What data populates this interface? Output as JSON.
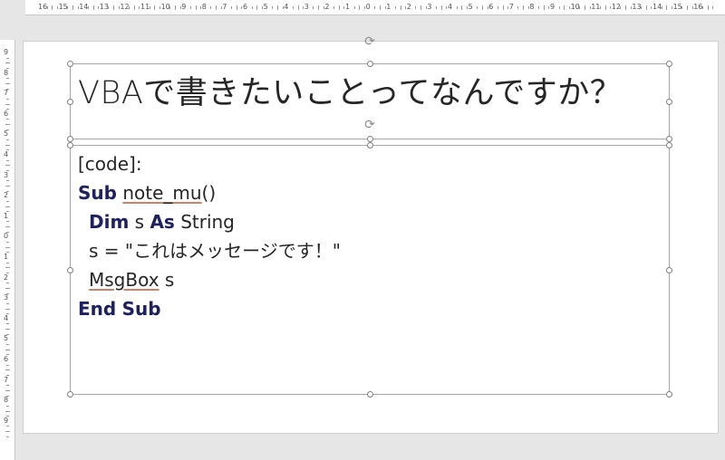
{
  "ruler": {
    "top_labels": [
      "16",
      "15",
      "14",
      "13",
      "12",
      "11",
      "10",
      "9",
      "8",
      "7",
      "6",
      "5",
      "4",
      "3",
      "2",
      "1",
      "0",
      "1",
      "2",
      "3",
      "4",
      "5",
      "6",
      "7",
      "8",
      "9",
      "10",
      "11",
      "12",
      "13",
      "14",
      "15",
      "16"
    ],
    "left_labels": [
      "9",
      "8",
      "7",
      "6",
      "5",
      "4",
      "3",
      "2",
      "1",
      "0",
      "1",
      "2",
      "3",
      "4",
      "5",
      "6",
      "7",
      "8",
      "9"
    ]
  },
  "slide": {
    "title": "VBAで書きたいことってなんですか？",
    "code": {
      "label": "[code]:",
      "line1": {
        "kw_sub": "Sub",
        "name": "note_mu",
        "paren": "()"
      },
      "line2": {
        "kw_dim": "Dim",
        "var": "s",
        "kw_as": "As",
        "type": "String"
      },
      "line3": {
        "text": "s = \"これはメッセージです！\""
      },
      "line4": {
        "func": "MsgBox",
        "arg": "s"
      },
      "line5": {
        "kw_end": "End",
        "kw_sub": "Sub"
      }
    }
  },
  "colors": {
    "keyword": "#1f2060",
    "text": "#262626",
    "selection_border": "#a6a6a6"
  }
}
